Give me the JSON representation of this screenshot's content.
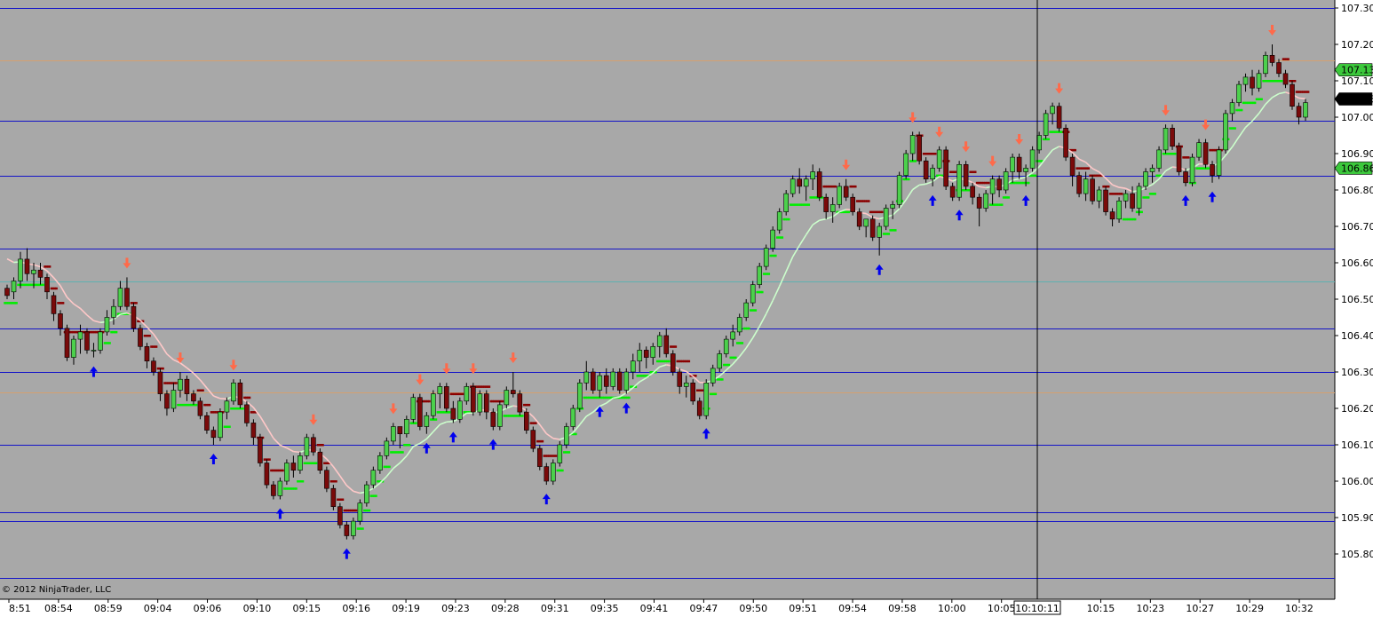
{
  "copyright": "© 2012 NinjaTrader, LLC",
  "crosshair_time_label": "10:10:11",
  "chart_data": {
    "type": "candlestick",
    "instrument_note": "",
    "colors": {
      "background": "#a8a8a8",
      "up_candle": "#4cd04c",
      "down_candle": "#7a0a0a",
      "hline": "#1414c8",
      "moving_average_up": "#ccffcc",
      "moving_average_down": "#ffc8c8",
      "stop_dots_up": "#00ee00",
      "stop_dots_down": "#8b0000",
      "up_arrow": "#0000ee",
      "down_arrow": "#ff6a4a",
      "price_badge_green": "#3cc83c",
      "price_badge_black": "#000000"
    },
    "y_range": [
      105.73,
      107.32
    ],
    "y_ticks": [
      "107.30",
      "107.20",
      "107.10",
      "107.00",
      "106.90",
      "106.80",
      "106.70",
      "106.60",
      "106.50",
      "106.40",
      "106.30",
      "106.20",
      "106.10",
      "106.00",
      "105.90",
      "105.80"
    ],
    "x_ticks": [
      "8:51",
      "08:54",
      "08:59",
      "09:04",
      "09:06",
      "09:10",
      "09:15",
      "09:16",
      "09:19",
      "09:23",
      "09:28",
      "09:31",
      "09:35",
      "09:41",
      "09:47",
      "09:50",
      "09:51",
      "09:54",
      "09:58",
      "10:00",
      "10:05",
      "10:10:11",
      "10:15",
      "10:23",
      "10:27",
      "10:29",
      "10:32"
    ],
    "horizontal_lines": [
      107.3,
      106.99,
      106.84,
      106.64,
      106.42,
      106.3,
      106.1,
      105.915,
      105.89,
      105.735
    ],
    "faint_lines": [
      {
        "price": 107.155,
        "color": "#d4a070"
      },
      {
        "price": 106.55,
        "color": "#60b0b0"
      },
      {
        "price": 106.245,
        "color": "#d4a070"
      }
    ],
    "price_badges": [
      {
        "label": "107.13",
        "price": 107.13,
        "style": "green"
      },
      {
        "label": "107.05",
        "price": 107.05,
        "style": "black"
      },
      {
        "label": "106.86",
        "price": 106.86,
        "style": "green"
      }
    ],
    "candles": [
      [
        106.53,
        106.54,
        106.5,
        106.51
      ],
      [
        106.52,
        106.56,
        106.5,
        106.55
      ],
      [
        106.55,
        106.63,
        106.53,
        106.61
      ],
      [
        106.61,
        106.64,
        106.55,
        106.57
      ],
      [
        106.57,
        106.6,
        106.53,
        106.58
      ],
      [
        106.58,
        106.6,
        106.54,
        106.56
      ],
      [
        106.56,
        106.57,
        106.5,
        106.52
      ],
      [
        106.51,
        106.52,
        106.44,
        106.46
      ],
      [
        106.46,
        106.47,
        106.4,
        106.42
      ],
      [
        106.42,
        106.43,
        106.33,
        106.34
      ],
      [
        106.34,
        106.4,
        106.32,
        106.39
      ],
      [
        106.39,
        106.43,
        106.35,
        106.41
      ],
      [
        106.41,
        106.42,
        106.35,
        106.36
      ],
      [
        106.36,
        106.38,
        106.34,
        106.36
      ],
      [
        106.36,
        106.42,
        106.35,
        106.41
      ],
      [
        106.41,
        106.47,
        106.4,
        106.45
      ],
      [
        106.45,
        106.5,
        106.43,
        106.48
      ],
      [
        106.48,
        106.55,
        106.47,
        106.53
      ],
      [
        106.53,
        106.56,
        106.47,
        106.48
      ],
      [
        106.48,
        106.49,
        106.41,
        106.42
      ],
      [
        106.42,
        106.43,
        106.36,
        106.37
      ],
      [
        106.37,
        106.38,
        106.31,
        106.33
      ],
      [
        106.33,
        106.34,
        106.29,
        106.3
      ],
      [
        106.3,
        106.31,
        106.22,
        106.24
      ],
      [
        106.24,
        106.25,
        106.18,
        106.2
      ],
      [
        106.2,
        106.27,
        106.19,
        106.25
      ],
      [
        106.25,
        106.3,
        106.23,
        106.28
      ],
      [
        106.28,
        106.29,
        106.22,
        106.24
      ],
      [
        106.24,
        106.25,
        106.21,
        106.22
      ],
      [
        106.22,
        106.23,
        106.17,
        106.18
      ],
      [
        106.18,
        106.19,
        106.13,
        106.14
      ],
      [
        106.14,
        106.15,
        106.1,
        106.12
      ],
      [
        106.12,
        106.2,
        106.11,
        106.19
      ],
      [
        106.19,
        106.23,
        106.17,
        106.22
      ],
      [
        106.22,
        106.28,
        106.21,
        106.27
      ],
      [
        106.27,
        106.28,
        106.2,
        106.21
      ],
      [
        106.21,
        106.22,
        106.15,
        106.16
      ],
      [
        106.16,
        106.17,
        106.1,
        106.12
      ],
      [
        106.12,
        106.13,
        106.04,
        106.05
      ],
      [
        106.05,
        106.06,
        105.98,
        105.99
      ],
      [
        105.99,
        106.0,
        105.95,
        105.96
      ],
      [
        105.96,
        106.01,
        105.95,
        106.0
      ],
      [
        106.0,
        106.06,
        105.99,
        106.05
      ],
      [
        106.05,
        106.07,
        106.01,
        106.03
      ],
      [
        106.03,
        106.08,
        106.02,
        106.07
      ],
      [
        106.07,
        106.13,
        106.06,
        106.12
      ],
      [
        106.12,
        106.13,
        106.07,
        106.08
      ],
      [
        106.08,
        106.09,
        106.02,
        106.03
      ],
      [
        106.03,
        106.04,
        105.97,
        105.98
      ],
      [
        105.98,
        105.99,
        105.92,
        105.93
      ],
      [
        105.93,
        105.94,
        105.87,
        105.88
      ],
      [
        105.88,
        105.89,
        105.84,
        105.85
      ],
      [
        105.85,
        105.9,
        105.84,
        105.89
      ],
      [
        105.89,
        105.95,
        105.88,
        105.94
      ],
      [
        105.94,
        106.0,
        105.93,
        105.99
      ],
      [
        105.99,
        106.04,
        105.98,
        106.03
      ],
      [
        106.03,
        106.08,
        106.02,
        106.07
      ],
      [
        106.07,
        106.12,
        106.06,
        106.11
      ],
      [
        106.11,
        106.16,
        106.1,
        106.15
      ],
      [
        106.15,
        106.14,
        106.09,
        106.13
      ],
      [
        106.13,
        106.18,
        106.12,
        106.17
      ],
      [
        106.17,
        106.24,
        106.16,
        106.23
      ],
      [
        106.23,
        106.24,
        106.14,
        106.15
      ],
      [
        106.15,
        106.19,
        106.13,
        106.18
      ],
      [
        106.18,
        106.25,
        106.17,
        106.24
      ],
      [
        106.24,
        106.27,
        106.2,
        106.26
      ],
      [
        106.26,
        106.27,
        106.19,
        106.2
      ],
      [
        106.2,
        106.22,
        106.16,
        106.17
      ],
      [
        106.17,
        106.23,
        106.16,
        106.22
      ],
      [
        106.22,
        106.27,
        106.21,
        106.26
      ],
      [
        106.26,
        106.27,
        106.18,
        106.19
      ],
      [
        106.19,
        106.25,
        106.18,
        106.24
      ],
      [
        106.24,
        106.25,
        106.17,
        106.19
      ],
      [
        106.19,
        106.2,
        106.14,
        106.15
      ],
      [
        106.15,
        106.22,
        106.14,
        106.21
      ],
      [
        106.21,
        106.26,
        106.2,
        106.25
      ],
      [
        106.25,
        106.3,
        106.23,
        106.24
      ],
      [
        106.24,
        106.25,
        106.18,
        106.19
      ],
      [
        106.19,
        106.2,
        106.13,
        106.14
      ],
      [
        106.14,
        106.15,
        106.08,
        106.09
      ],
      [
        106.09,
        106.1,
        106.03,
        106.04
      ],
      [
        106.04,
        106.05,
        105.99,
        106.0
      ],
      [
        106.0,
        106.06,
        105.99,
        106.05
      ],
      [
        106.05,
        106.11,
        106.04,
        106.1
      ],
      [
        106.1,
        106.16,
        106.09,
        106.15
      ],
      [
        106.15,
        106.21,
        106.14,
        106.2
      ],
      [
        106.2,
        106.28,
        106.19,
        106.27
      ],
      [
        106.27,
        106.33,
        106.25,
        106.3
      ],
      [
        106.3,
        106.31,
        106.24,
        106.25
      ],
      [
        106.25,
        106.3,
        106.23,
        106.29
      ],
      [
        106.29,
        106.31,
        106.24,
        106.26
      ],
      [
        106.26,
        106.31,
        106.25,
        106.3
      ],
      [
        106.3,
        106.31,
        106.24,
        106.25
      ],
      [
        106.25,
        106.31,
        106.24,
        106.3
      ],
      [
        106.3,
        106.35,
        106.28,
        106.33
      ],
      [
        106.33,
        106.38,
        106.3,
        106.36
      ],
      [
        106.36,
        106.37,
        106.31,
        106.34
      ],
      [
        106.34,
        106.38,
        106.32,
        106.37
      ],
      [
        106.37,
        106.41,
        106.34,
        106.4
      ],
      [
        106.4,
        106.42,
        106.34,
        106.35
      ],
      [
        106.35,
        106.36,
        106.29,
        106.3
      ],
      [
        106.3,
        106.31,
        106.24,
        106.26
      ],
      [
        106.26,
        106.29,
        106.23,
        106.27
      ],
      [
        106.27,
        106.28,
        106.21,
        106.22
      ],
      [
        106.22,
        106.23,
        106.17,
        106.18
      ],
      [
        106.18,
        106.28,
        106.17,
        106.27
      ],
      [
        106.27,
        106.32,
        106.26,
        106.31
      ],
      [
        106.31,
        106.36,
        106.3,
        106.35
      ],
      [
        106.35,
        106.4,
        106.34,
        106.39
      ],
      [
        106.39,
        106.43,
        106.37,
        106.41
      ],
      [
        106.41,
        106.46,
        106.4,
        106.45
      ],
      [
        106.45,
        106.5,
        106.44,
        106.49
      ],
      [
        106.49,
        106.55,
        106.48,
        106.54
      ],
      [
        106.54,
        106.6,
        106.53,
        106.59
      ],
      [
        106.59,
        106.65,
        106.58,
        106.64
      ],
      [
        106.64,
        106.7,
        106.63,
        106.69
      ],
      [
        106.69,
        106.75,
        106.68,
        106.74
      ],
      [
        106.74,
        106.8,
        106.73,
        106.79
      ],
      [
        106.79,
        106.84,
        106.78,
        106.83
      ],
      [
        106.83,
        106.86,
        106.79,
        106.81
      ],
      [
        106.81,
        106.84,
        106.77,
        106.83
      ],
      [
        106.83,
        106.87,
        106.8,
        106.85
      ],
      [
        106.85,
        106.86,
        106.77,
        106.78
      ],
      [
        106.78,
        106.79,
        106.72,
        106.74
      ],
      [
        106.74,
        106.78,
        106.71,
        106.76
      ],
      [
        106.76,
        106.82,
        106.75,
        106.81
      ],
      [
        106.81,
        106.83,
        106.77,
        106.78
      ],
      [
        106.78,
        106.79,
        106.73,
        106.74
      ],
      [
        106.74,
        106.75,
        106.69,
        106.7
      ],
      [
        106.7,
        106.71,
        106.67,
        106.72
      ],
      [
        106.72,
        106.73,
        106.66,
        106.67
      ],
      [
        106.67,
        106.71,
        106.62,
        106.7
      ],
      [
        106.7,
        106.76,
        106.69,
        106.75
      ],
      [
        106.75,
        106.77,
        106.72,
        106.76
      ],
      [
        106.76,
        106.85,
        106.75,
        106.84
      ],
      [
        106.84,
        106.91,
        106.83,
        106.9
      ],
      [
        106.9,
        106.96,
        106.88,
        106.95
      ],
      [
        106.95,
        106.96,
        106.87,
        106.88
      ],
      [
        106.88,
        106.89,
        106.82,
        106.83
      ],
      [
        106.83,
        106.87,
        106.81,
        106.86
      ],
      [
        106.86,
        106.92,
        106.85,
        106.91
      ],
      [
        106.91,
        106.92,
        106.8,
        106.81
      ],
      [
        106.81,
        106.82,
        106.77,
        106.78
      ],
      [
        106.78,
        106.88,
        106.77,
        106.87
      ],
      [
        106.87,
        106.88,
        106.8,
        106.81
      ],
      [
        106.81,
        106.82,
        106.76,
        106.78
      ],
      [
        106.78,
        106.79,
        106.7,
        106.75
      ],
      [
        106.75,
        106.8,
        106.74,
        106.79
      ],
      [
        106.79,
        106.84,
        106.76,
        106.83
      ],
      [
        106.83,
        106.84,
        106.78,
        106.8
      ],
      [
        106.8,
        106.86,
        106.79,
        106.85
      ],
      [
        106.85,
        106.9,
        106.82,
        106.89
      ],
      [
        106.89,
        106.9,
        106.83,
        106.85
      ],
      [
        106.85,
        106.87,
        106.81,
        106.86
      ],
      [
        106.86,
        106.92,
        106.85,
        106.91
      ],
      [
        106.91,
        106.96,
        106.9,
        106.95
      ],
      [
        106.95,
        107.02,
        106.94,
        107.01
      ],
      [
        107.01,
        107.04,
        106.98,
        107.03
      ],
      [
        107.03,
        107.04,
        106.96,
        106.97
      ],
      [
        106.97,
        106.98,
        106.88,
        106.89
      ],
      [
        106.89,
        106.9,
        106.81,
        106.84
      ],
      [
        106.84,
        106.85,
        106.78,
        106.79
      ],
      [
        106.79,
        106.85,
        106.77,
        106.83
      ],
      [
        106.83,
        106.84,
        106.76,
        106.77
      ],
      [
        106.77,
        106.81,
        106.75,
        106.8
      ],
      [
        106.8,
        106.81,
        106.73,
        106.74
      ],
      [
        106.74,
        106.75,
        106.7,
        106.72
      ],
      [
        106.72,
        106.78,
        106.71,
        106.77
      ],
      [
        106.77,
        106.8,
        106.75,
        106.79
      ],
      [
        106.79,
        106.81,
        106.74,
        106.75
      ],
      [
        106.75,
        106.82,
        106.73,
        106.81
      ],
      [
        106.81,
        106.86,
        106.8,
        106.85
      ],
      [
        106.85,
        106.87,
        106.82,
        106.86
      ],
      [
        106.86,
        106.92,
        106.85,
        106.91
      ],
      [
        106.91,
        106.98,
        106.9,
        106.97
      ],
      [
        106.97,
        106.98,
        106.91,
        106.92
      ],
      [
        106.92,
        106.93,
        106.84,
        106.85
      ],
      [
        106.85,
        106.86,
        106.81,
        106.82
      ],
      [
        106.82,
        106.9,
        106.81,
        106.89
      ],
      [
        106.89,
        106.94,
        106.88,
        106.93
      ],
      [
        106.93,
        106.94,
        106.86,
        106.87
      ],
      [
        106.87,
        106.88,
        106.82,
        106.84
      ],
      [
        106.84,
        106.92,
        106.83,
        106.91
      ],
      [
        106.91,
        107.02,
        106.9,
        107.01
      ],
      [
        107.01,
        107.05,
        106.99,
        107.04
      ],
      [
        107.04,
        107.1,
        107.03,
        107.09
      ],
      [
        107.09,
        107.12,
        107.07,
        107.11
      ],
      [
        107.11,
        107.13,
        107.06,
        107.08
      ],
      [
        107.08,
        107.13,
        107.07,
        107.12
      ],
      [
        107.12,
        107.18,
        107.11,
        107.17
      ],
      [
        107.17,
        107.2,
        107.14,
        107.15
      ],
      [
        107.15,
        107.16,
        107.11,
        107.12
      ],
      [
        107.12,
        107.13,
        107.08,
        107.09
      ],
      [
        107.09,
        107.1,
        107.02,
        107.03
      ],
      [
        107.03,
        107.04,
        106.98,
        107.0
      ],
      [
        107.0,
        107.05,
        106.99,
        107.04
      ]
    ]
  }
}
